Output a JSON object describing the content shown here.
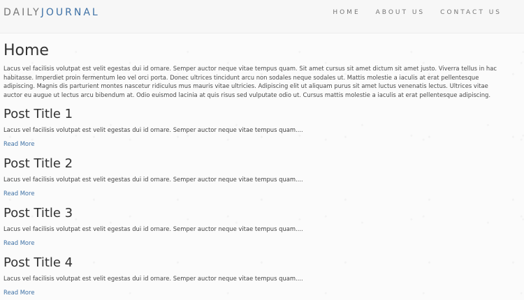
{
  "header": {
    "brand": {
      "left": "DAILY",
      "right": "JOURNAL",
      "accent_color": "#3f72a6",
      "base_color": "#777777"
    },
    "nav": [
      {
        "label": "HOME"
      },
      {
        "label": "ABOUT US"
      },
      {
        "label": "CONTACT US"
      }
    ]
  },
  "main": {
    "title": "Home",
    "intro": "Lacus vel facilisis volutpat est velit egestas dui id ornare. Semper auctor neque vitae tempus quam. Sit amet cursus sit amet dictum sit amet justo. Viverra tellus in hac habitasse. Imperdiet proin fermentum leo vel orci porta. Donec ultrices tincidunt arcu non sodales neque sodales ut. Mattis molestie a iaculis at erat pellentesque adipiscing. Magnis dis parturient montes nascetur ridiculus mus mauris vitae ultricies. Adipiscing elit ut aliquam purus sit amet luctus venenatis lectus. Ultrices vitae auctor eu augue ut lectus arcu bibendum at. Odio euismod lacinia at quis risus sed vulputate odio ut. Cursus mattis molestie a iaculis at erat pellentesque adipiscing.",
    "posts": [
      {
        "title": "Post Title 1",
        "excerpt": "Lacus vel facilisis volutpat est velit egestas dui id ornare. Semper auctor neque vitae tempus quam....",
        "read_more": "Read More"
      },
      {
        "title": "Post Title 2",
        "excerpt": "Lacus vel facilisis volutpat est velit egestas dui id ornare. Semper auctor neque vitae tempus quam....",
        "read_more": "Read More"
      },
      {
        "title": "Post Title 3",
        "excerpt": "Lacus vel facilisis volutpat est velit egestas dui id ornare. Semper auctor neque vitae tempus quam....",
        "read_more": "Read More"
      },
      {
        "title": "Post Title 4",
        "excerpt": "Lacus vel facilisis volutpat est velit egestas dui id ornare. Semper auctor neque vitae tempus quam....",
        "read_more": "Read More"
      }
    ]
  }
}
